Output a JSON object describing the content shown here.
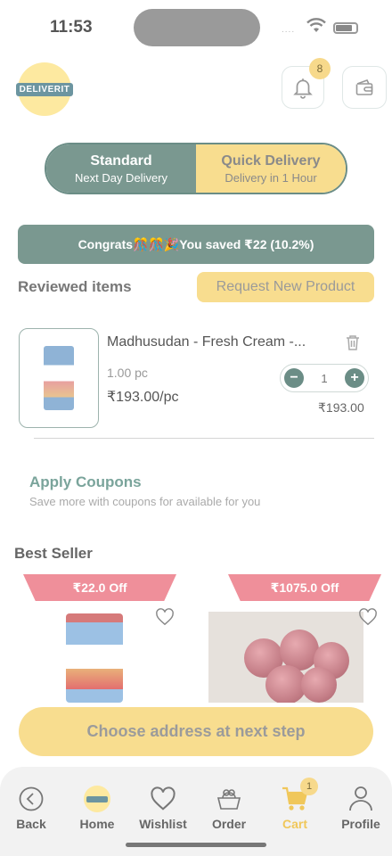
{
  "status_bar": {
    "time": "11:53",
    "signal": "...."
  },
  "header": {
    "logo_text": "DELIVERIT",
    "notification_count": "8"
  },
  "delivery_toggle": {
    "standard_title": "Standard",
    "standard_subtitle": "Next Day Delivery",
    "quick_title": "Quick Delivery",
    "quick_subtitle": "Delivery in 1 Hour",
    "selected": "standard"
  },
  "savings_banner": "Congrats🎊🎊🎉You saved ₹22 (10.2%)",
  "reviewed": {
    "title": "Reviewed items",
    "request_button": "Request New Product"
  },
  "cart_item": {
    "name": "Madhusudan - Fresh Cream -...",
    "quantity_unit": "1.00 pc",
    "unit_price": "₹193.00/pc",
    "quantity": "1",
    "minus": "−",
    "plus": "+",
    "total": "₹193.00"
  },
  "coupons": {
    "title": "Apply Coupons",
    "subtitle": "Save more with coupons for available for you"
  },
  "best_seller": {
    "title": "Best Seller",
    "products": [
      {
        "off_label": "₹22.0 Off"
      },
      {
        "off_label": "₹1075.0 Off"
      }
    ]
  },
  "checkout_button": "Choose address at next step",
  "bottom_nav": {
    "items": [
      {
        "label": "Back",
        "icon": "back-arrow-icon"
      },
      {
        "label": "Home",
        "icon": "home-logo-icon"
      },
      {
        "label": "Wishlist",
        "icon": "heart-icon"
      },
      {
        "label": "Order",
        "icon": "basket-icon"
      },
      {
        "label": "Cart",
        "icon": "cart-icon",
        "badge": "1"
      },
      {
        "label": "Profile",
        "icon": "person-icon"
      }
    ],
    "active": "Cart"
  },
  "colors": {
    "primary_green": "#7a9890",
    "accent_yellow": "#f8dd8f",
    "discount_pink": "#ef8f9a",
    "coupon_green": "#7aa49b"
  }
}
